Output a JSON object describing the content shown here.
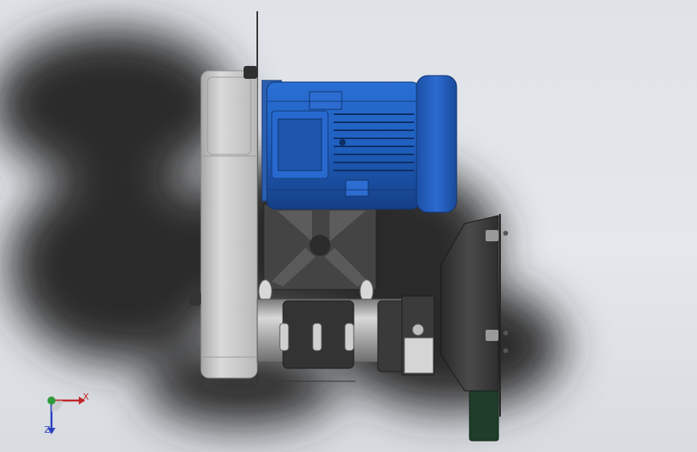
{
  "viewport": {
    "background": "#e2e5e9",
    "model": {
      "components": [
        "belt-guard-housing",
        "electric-motor",
        "motor-fan-cowl",
        "motor-mounting-bracket",
        "shaft-housing",
        "bearing-block",
        "grinding-wheel-guard",
        "grinding-wheel"
      ],
      "colors": {
        "motor": "#1f5fbf",
        "motor_dark": "#17438a",
        "housing": "#c9c9c9",
        "bracket": "#3f3f3f",
        "wheel": "#1f3d2a"
      }
    }
  },
  "triad": {
    "x_label": "X",
    "z_label": "Z",
    "colors": {
      "x": "#c0262a",
      "y": "#2e9c3a",
      "z": "#2a3fbf"
    }
  }
}
